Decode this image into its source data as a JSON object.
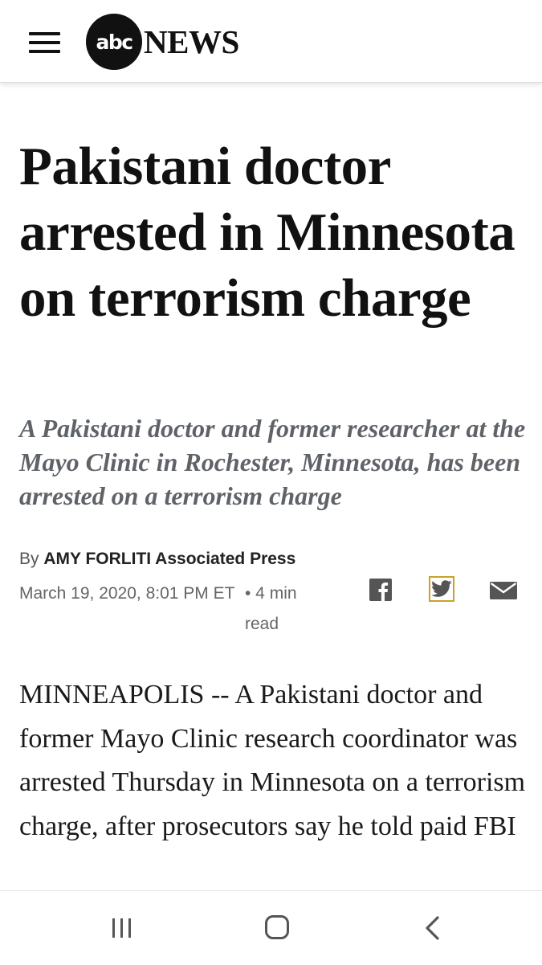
{
  "header": {
    "logo_badge": "abc",
    "logo_word": "NEWS"
  },
  "article": {
    "headline": "Pakistani doctor arrested in Minnesota on terrorism charge",
    "subheadline": "A Pakistani doctor and former researcher at the Mayo Clinic in Rochester, Minnesota, has been arrested on a terrorism charge",
    "byline_prefix": "By",
    "author": "AMY FORLITI Associated Press",
    "date": "March 19, 2020, 8:01 PM ET",
    "read_time": "• 4 min read",
    "body": "MINNEAPOLIS -- A Pakistani doctor and former Mayo Clinic research coordinator was arrested Thursday in Minnesota on a terrorism charge, after prosecutors say he told paid FBI"
  },
  "share": {
    "icons": [
      "facebook-icon",
      "twitter-icon",
      "email-icon"
    ],
    "highlight_color": "#c9a227"
  },
  "nav_bar": {
    "icons": [
      "recents-icon",
      "home-icon",
      "back-icon"
    ]
  }
}
